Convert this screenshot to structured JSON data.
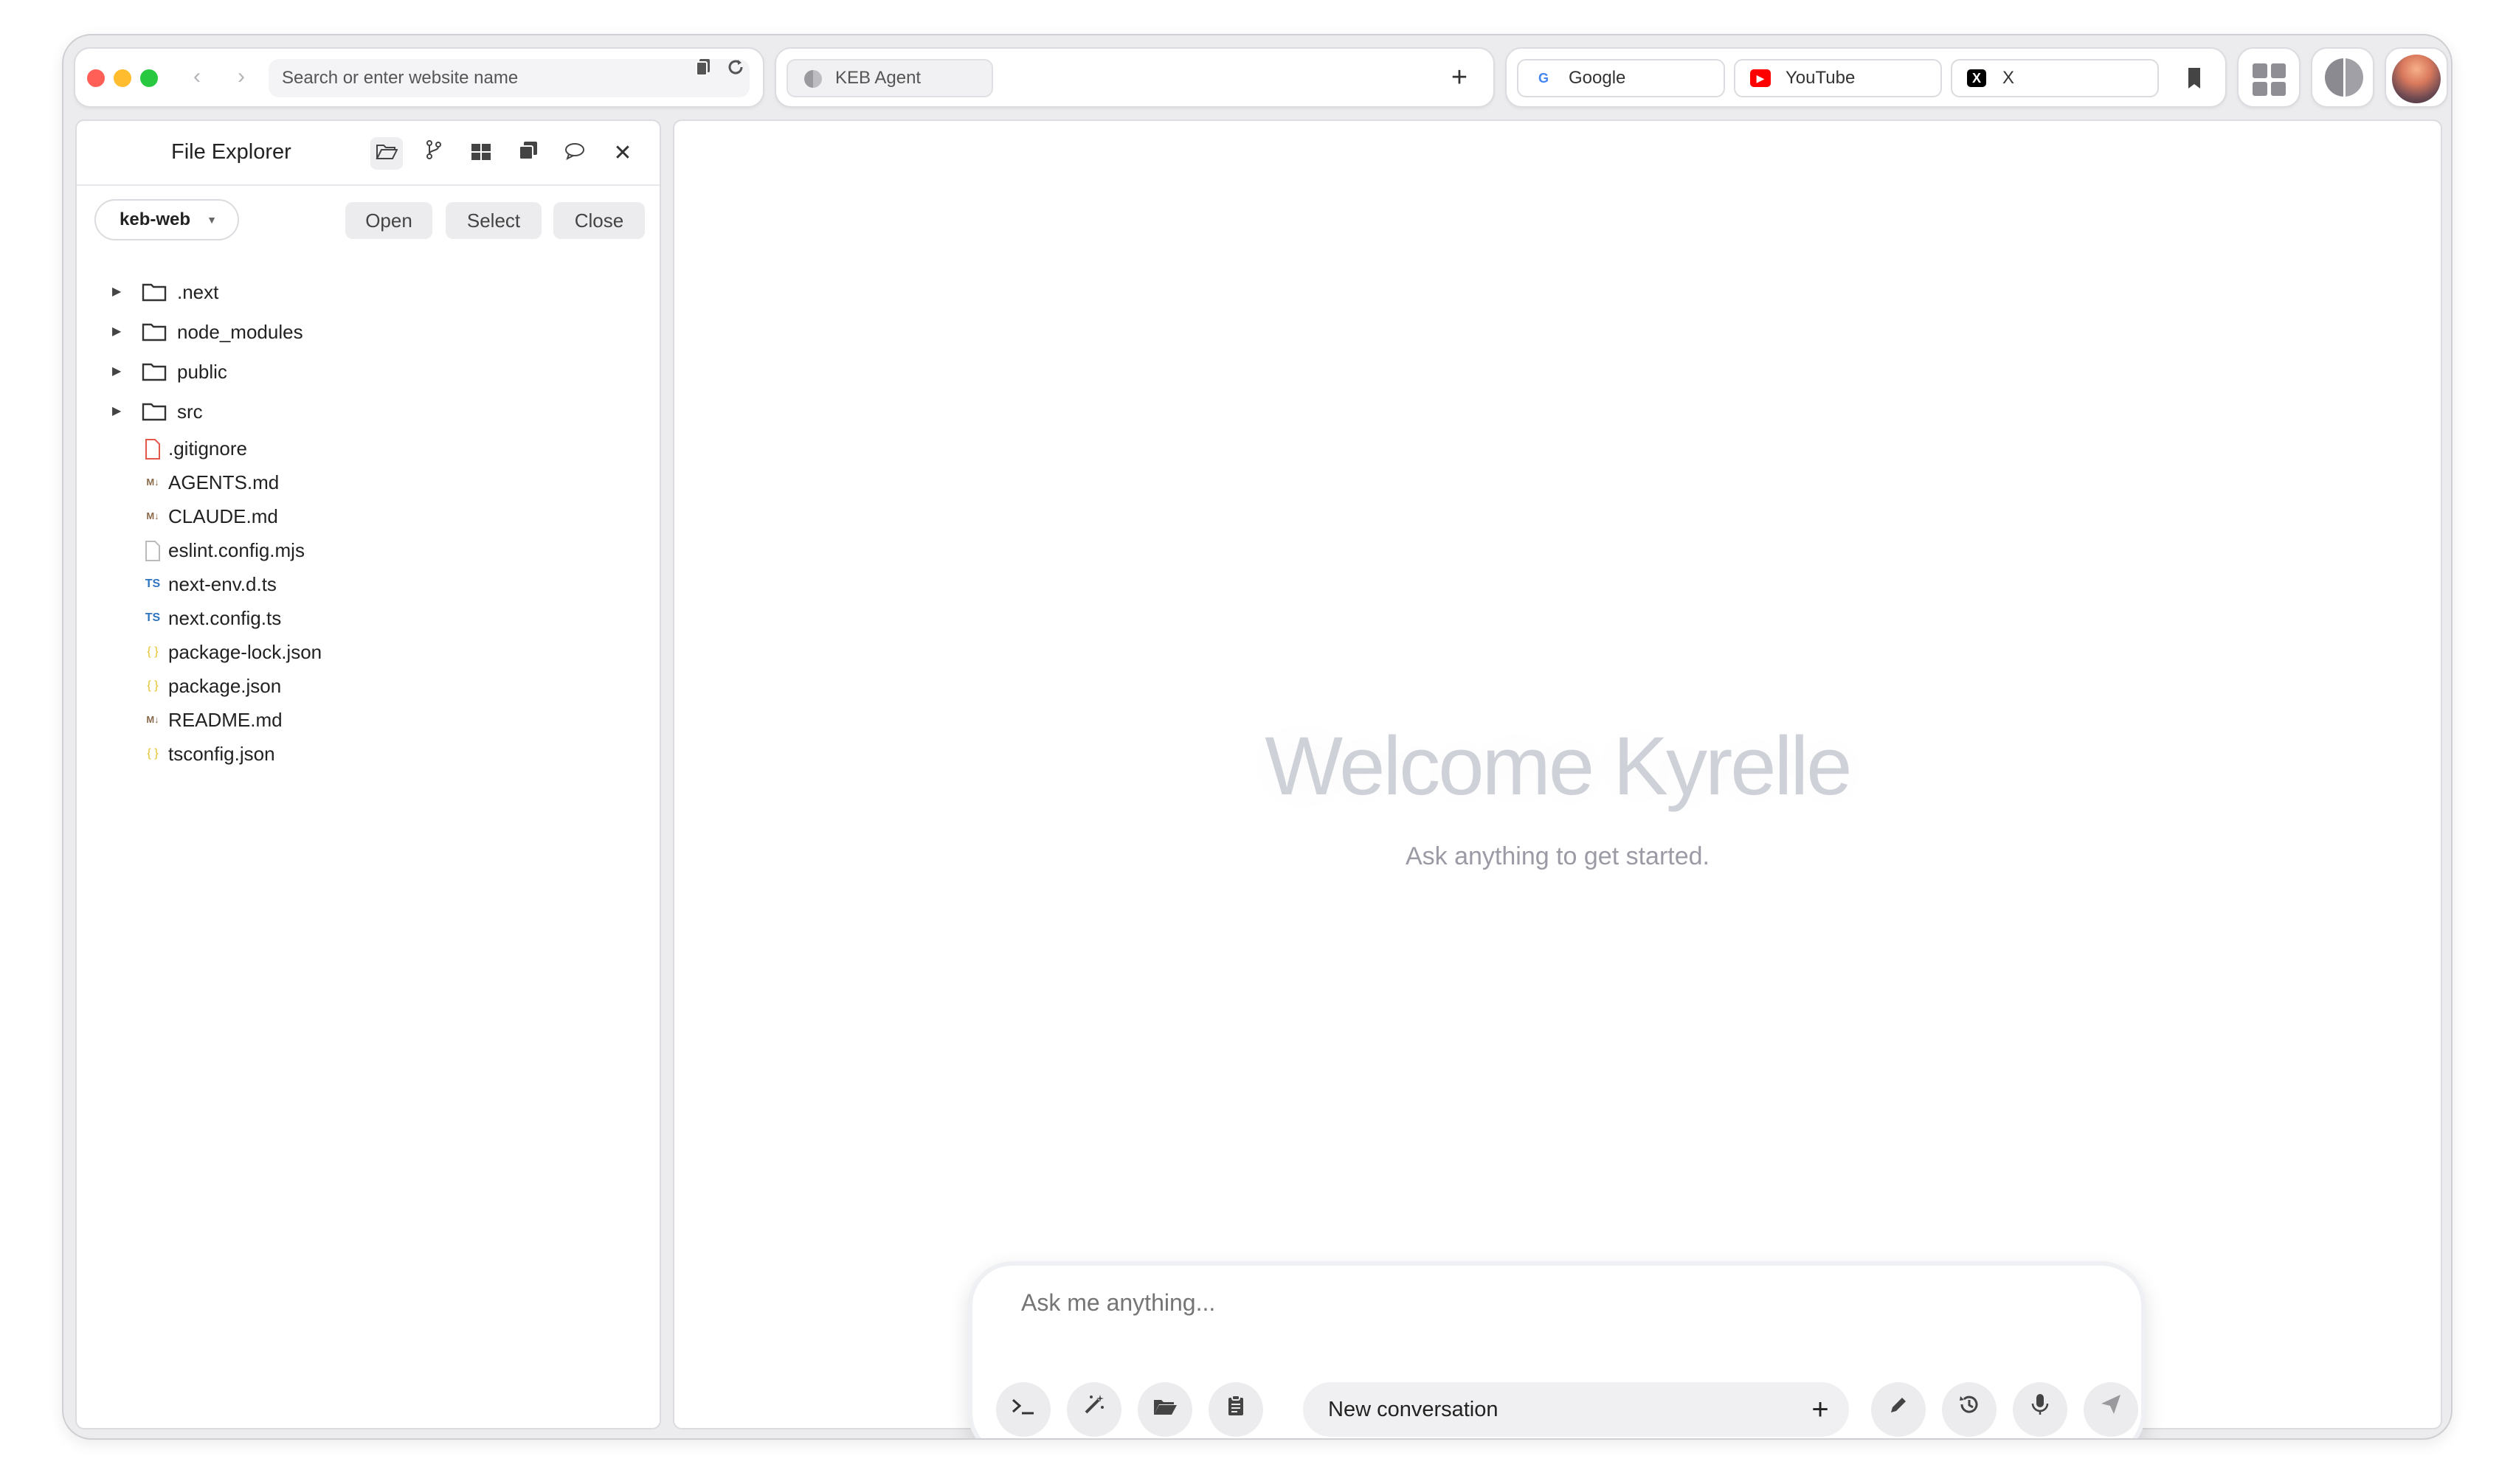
{
  "toolbar": {
    "address_placeholder": "Search or enter website name",
    "back_icon": "chevron-left-icon",
    "forward_icon": "chevron-right-icon"
  },
  "tabs": [
    {
      "label": "KEB Agent",
      "icon": "brain-icon"
    }
  ],
  "bookmarks": [
    {
      "label": "Google",
      "icon": "google-icon",
      "color": "#4285F4"
    },
    {
      "label": "YouTube",
      "icon": "youtube-icon",
      "color": "#FF0000"
    },
    {
      "label": "X",
      "icon": "x-icon",
      "color": "#000000"
    }
  ],
  "sidebar": {
    "title": "File Explorer",
    "repo": "keb-web",
    "buttons": {
      "open": "Open",
      "select": "Select",
      "close": "Close"
    },
    "folders": [
      ".next",
      "node_modules",
      "public",
      "src"
    ],
    "files": [
      {
        "name": ".gitignore",
        "icon": "file-icon",
        "color": "#e4574b"
      },
      {
        "name": "AGENTS.md",
        "icon": "markdown-icon",
        "color": "#8a6a4a"
      },
      {
        "name": "CLAUDE.md",
        "icon": "markdown-icon",
        "color": "#8a6a4a"
      },
      {
        "name": "eslint.config.mjs",
        "icon": "file-icon",
        "color": "#bbbbbb"
      },
      {
        "name": "next-env.d.ts",
        "icon": "typescript-icon",
        "color": "#2f74c0"
      },
      {
        "name": "next.config.ts",
        "icon": "typescript-icon",
        "color": "#2f74c0"
      },
      {
        "name": "package-lock.json",
        "icon": "json-icon",
        "color": "#e6c229"
      },
      {
        "name": "package.json",
        "icon": "json-icon",
        "color": "#e6c229"
      },
      {
        "name": "README.md",
        "icon": "markdown-icon",
        "color": "#8a6a4a"
      },
      {
        "name": "tsconfig.json",
        "icon": "json-icon",
        "color": "#e6c229"
      }
    ]
  },
  "main": {
    "welcome": "Welcome Kyrelle",
    "subtitle": "Ask anything to get started.",
    "composer": {
      "placeholder": "Ask me anything...",
      "conversation": "New conversation"
    }
  }
}
